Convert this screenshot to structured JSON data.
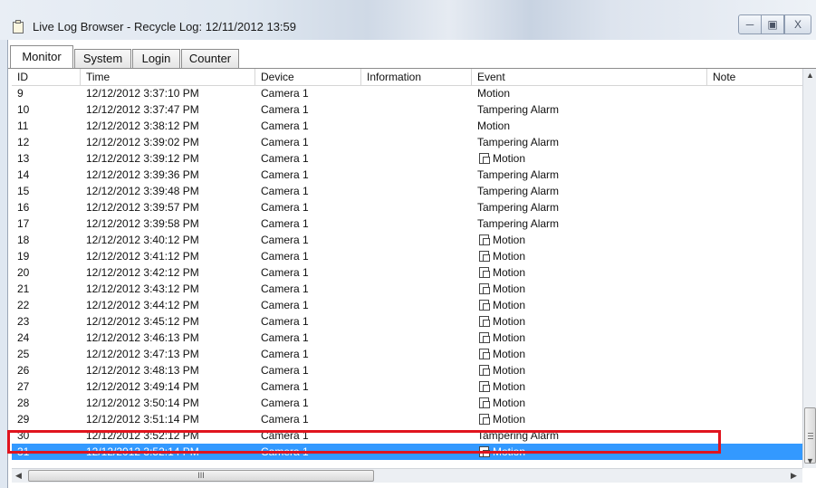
{
  "window": {
    "title_prefix": "Live Log Browser - ",
    "title_suffix": "Recycle Log: 12/11/2012 13:59",
    "min_glyph": "─",
    "max_glyph": "▣",
    "close_glyph": "X"
  },
  "tabs": [
    {
      "label": "Monitor",
      "active": true
    },
    {
      "label": "System",
      "active": false
    },
    {
      "label": "Login",
      "active": false
    },
    {
      "label": "Counter",
      "active": false
    }
  ],
  "columns": [
    "ID",
    "Time",
    "Device",
    "Information",
    "Event",
    "Note"
  ],
  "rows": [
    {
      "id": "9",
      "time": "12/12/2012 3:37:10 PM",
      "device": "Camera 1",
      "info": "",
      "event": "Motion",
      "icon": false,
      "note": ""
    },
    {
      "id": "10",
      "time": "12/12/2012 3:37:47 PM",
      "device": "Camera 1",
      "info": "",
      "event": "Tampering Alarm",
      "icon": false,
      "note": ""
    },
    {
      "id": "11",
      "time": "12/12/2012 3:38:12 PM",
      "device": "Camera 1",
      "info": "",
      "event": "Motion",
      "icon": false,
      "note": ""
    },
    {
      "id": "12",
      "time": "12/12/2012 3:39:02 PM",
      "device": "Camera 1",
      "info": "",
      "event": "Tampering Alarm",
      "icon": false,
      "note": ""
    },
    {
      "id": "13",
      "time": "12/12/2012 3:39:12 PM",
      "device": "Camera 1",
      "info": "",
      "event": "Motion",
      "icon": true,
      "note": ""
    },
    {
      "id": "14",
      "time": "12/12/2012 3:39:36 PM",
      "device": "Camera 1",
      "info": "",
      "event": "Tampering Alarm",
      "icon": false,
      "note": ""
    },
    {
      "id": "15",
      "time": "12/12/2012 3:39:48 PM",
      "device": "Camera 1",
      "info": "",
      "event": "Tampering Alarm",
      "icon": false,
      "note": ""
    },
    {
      "id": "16",
      "time": "12/12/2012 3:39:57 PM",
      "device": "Camera 1",
      "info": "",
      "event": "Tampering Alarm",
      "icon": false,
      "note": ""
    },
    {
      "id": "17",
      "time": "12/12/2012 3:39:58 PM",
      "device": "Camera 1",
      "info": "",
      "event": "Tampering Alarm",
      "icon": false,
      "note": ""
    },
    {
      "id": "18",
      "time": "12/12/2012 3:40:12 PM",
      "device": "Camera 1",
      "info": "",
      "event": "Motion",
      "icon": true,
      "note": ""
    },
    {
      "id": "19",
      "time": "12/12/2012 3:41:12 PM",
      "device": "Camera 1",
      "info": "",
      "event": "Motion",
      "icon": true,
      "note": ""
    },
    {
      "id": "20",
      "time": "12/12/2012 3:42:12 PM",
      "device": "Camera 1",
      "info": "",
      "event": "Motion",
      "icon": true,
      "note": ""
    },
    {
      "id": "21",
      "time": "12/12/2012 3:43:12 PM",
      "device": "Camera 1",
      "info": "",
      "event": "Motion",
      "icon": true,
      "note": ""
    },
    {
      "id": "22",
      "time": "12/12/2012 3:44:12 PM",
      "device": "Camera 1",
      "info": "",
      "event": "Motion",
      "icon": true,
      "note": ""
    },
    {
      "id": "23",
      "time": "12/12/2012 3:45:12 PM",
      "device": "Camera 1",
      "info": "",
      "event": "Motion",
      "icon": true,
      "note": ""
    },
    {
      "id": "24",
      "time": "12/12/2012 3:46:13 PM",
      "device": "Camera 1",
      "info": "",
      "event": "Motion",
      "icon": true,
      "note": ""
    },
    {
      "id": "25",
      "time": "12/12/2012 3:47:13 PM",
      "device": "Camera 1",
      "info": "",
      "event": "Motion",
      "icon": true,
      "note": ""
    },
    {
      "id": "26",
      "time": "12/12/2012 3:48:13 PM",
      "device": "Camera 1",
      "info": "",
      "event": "Motion",
      "icon": true,
      "note": ""
    },
    {
      "id": "27",
      "time": "12/12/2012 3:49:14 PM",
      "device": "Camera 1",
      "info": "",
      "event": "Motion",
      "icon": true,
      "note": ""
    },
    {
      "id": "28",
      "time": "12/12/2012 3:50:14 PM",
      "device": "Camera 1",
      "info": "",
      "event": "Motion",
      "icon": true,
      "note": ""
    },
    {
      "id": "29",
      "time": "12/12/2012 3:51:14 PM",
      "device": "Camera 1",
      "info": "",
      "event": "Motion",
      "icon": true,
      "note": ""
    },
    {
      "id": "30",
      "time": "12/12/2012 3:52:12 PM",
      "device": "Camera 1",
      "info": "",
      "event": "Tampering Alarm",
      "icon": false,
      "note": ""
    },
    {
      "id": "31",
      "time": "12/12/2012 3:52:14 PM",
      "device": "Camera 1",
      "info": "",
      "event": "Motion",
      "icon": true,
      "note": "",
      "selected": true
    }
  ],
  "scroll": {
    "h_thumb_glyph": "III",
    "left_arrow": "◀",
    "right_arrow": "▶",
    "up_arrow": "▲",
    "down_arrow": "▼"
  },
  "colors": {
    "selection": "#3399ff",
    "highlight_box": "#e0141e"
  }
}
